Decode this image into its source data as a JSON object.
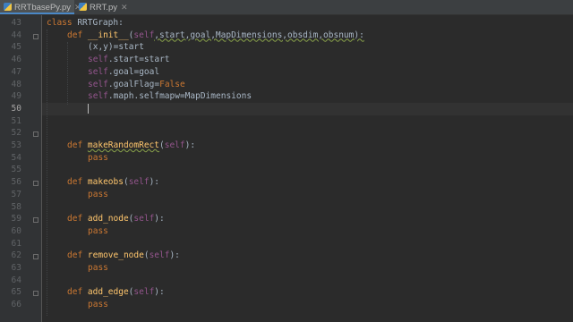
{
  "tabs": [
    {
      "label": "RRTbasePy.py",
      "active": true
    },
    {
      "label": "RRT.py",
      "active": false
    }
  ],
  "line_numbers": [
    "43",
    "44",
    "45",
    "46",
    "47",
    "48",
    "49",
    "50",
    "51",
    "52",
    "53",
    "54",
    "55",
    "56",
    "57",
    "58",
    "59",
    "60",
    "61",
    "62",
    "63",
    "64",
    "65",
    "66"
  ],
  "current_line": "50",
  "code": {
    "l43": {
      "kw": "class",
      "name": " RRTGraph:"
    },
    "l44": {
      "kw": "def",
      "fn": "__init__",
      "p1": "(",
      "self": "self",
      "rest": ",start,goal,MapDimensions,obsdim,obsnum):"
    },
    "l45": {
      "text": "(x,y)=start"
    },
    "l46": {
      "self": "self",
      "rest": ".start=start"
    },
    "l47": {
      "self": "self",
      "rest": ".goal=goal"
    },
    "l48": {
      "self": "self",
      "rest": ".goalFlag=",
      "kwval": "False"
    },
    "l49": {
      "self": "self",
      "rest": ".maph.selfmapw=MapDimensions"
    },
    "l53": {
      "kw": "def",
      "fn": "makeRandomRect",
      "p1": "(",
      "self": "self",
      "p2": "):"
    },
    "l54": {
      "kw": "pass"
    },
    "l56": {
      "kw": "def",
      "fn": "makeobs",
      "p1": "(",
      "self": "self",
      "p2": "):"
    },
    "l57": {
      "kw": "pass"
    },
    "l59": {
      "kw": "def",
      "fn": "add_node",
      "p1": "(",
      "self": "self",
      "p2": "):"
    },
    "l60": {
      "kw": "pass"
    },
    "l62": {
      "kw": "def",
      "fn": "remove_node",
      "p1": "(",
      "self": "self",
      "p2": "):"
    },
    "l63": {
      "kw": "pass"
    },
    "l65": {
      "kw": "def",
      "fn": "add_edge",
      "p1": "(",
      "self": "self",
      "p2": "):"
    },
    "l66": {
      "kw": "pass"
    }
  }
}
